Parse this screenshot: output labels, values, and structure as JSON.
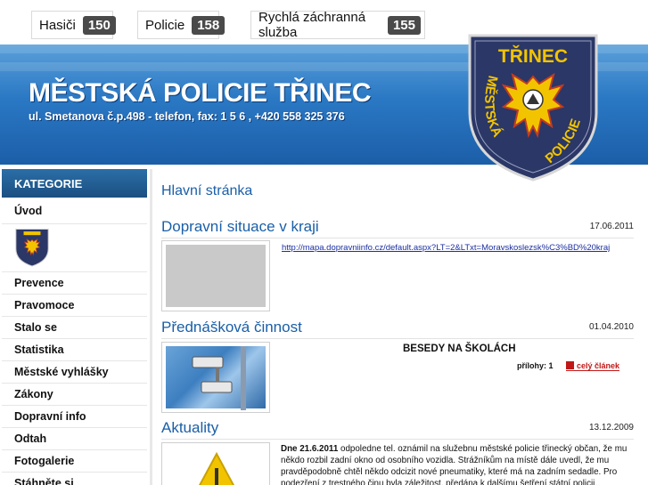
{
  "emergency": [
    {
      "label": "Hasiči",
      "number": "150"
    },
    {
      "label": "Policie",
      "number": "158"
    },
    {
      "label": "Rychlá záchranná služba",
      "number": "155"
    }
  ],
  "header": {
    "title": "MĚSTSKÁ POLICIE TŘINEC",
    "subtitle": "ul. Smetanova č.p.498 - telefon, fax: 1 5 6 , +420 558 325 376"
  },
  "badge": {
    "top_text": "TŘINEC",
    "left_text": "MĚSTSKÁ",
    "right_text": "POLICIE"
  },
  "sidebar": {
    "heading": "KATEGORIE",
    "items": [
      "Úvod",
      "Prevence",
      "Pravomoce",
      "Stalo se",
      "Statistika",
      "Městské vyhlášky",
      "Zákony",
      "Dopravní info",
      "Odtah",
      "Fotogalerie",
      "Stáhněte si"
    ]
  },
  "main": {
    "page_title": "Hlavní stránka",
    "articles": [
      {
        "title": "Dopravní situace v kraji",
        "date": "17.06.2011",
        "link": "http://mapa.dopravniinfo.cz/default.aspx?LT=2&LTxt=Moravskoslezsk%C3%BD%20kraj"
      },
      {
        "title": "Přednášková činnost",
        "date": "01.04.2010",
        "heading": "BESEDY NA ŠKOLÁCH",
        "attachments": "přílohy: 1",
        "full_link": "celý článek"
      },
      {
        "title": "Aktuality",
        "date": "13.12.2009",
        "lead_bold": "Dne 21.6.2011",
        "text": " odpoledne tel. oznámil na služebnu městské policie třinecký občan, že mu někdo rozbil zadní okno od osobního vozidla. Strážníkům na místě dále uvedl, že mu pravděpodobně chtěl někdo odcizit nové pneumatiky, které má na zadním sedadle. Pro podezření z trestného činu byla záležitost, předána k dalšímu šetření státní policii."
      }
    ]
  },
  "colors": {
    "banner": "#2a78c4",
    "link_title": "#1a5fa8",
    "sidebar_head": "#1b4f80",
    "alert_red": "#c01818"
  }
}
